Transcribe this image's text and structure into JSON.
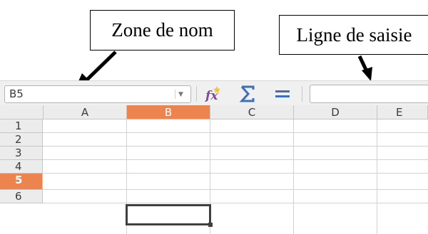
{
  "callouts": {
    "name_box_label": "Zone de nom",
    "input_line_label": "Ligne de saisie"
  },
  "toolbar": {
    "name_box_value": "B5",
    "icons": [
      "function-wizard-icon",
      "sum-icon",
      "formula-icon"
    ]
  },
  "sheet": {
    "columns": [
      "A",
      "B",
      "C",
      "D",
      "E"
    ],
    "rows": [
      "1",
      "2",
      "3",
      "4",
      "5",
      "6"
    ],
    "active_column": "B",
    "active_row": "5"
  },
  "colors": {
    "active_header": "#ec8450",
    "sum_icon": "#3f6fb6",
    "fx_icon": "#7d4b9a"
  }
}
